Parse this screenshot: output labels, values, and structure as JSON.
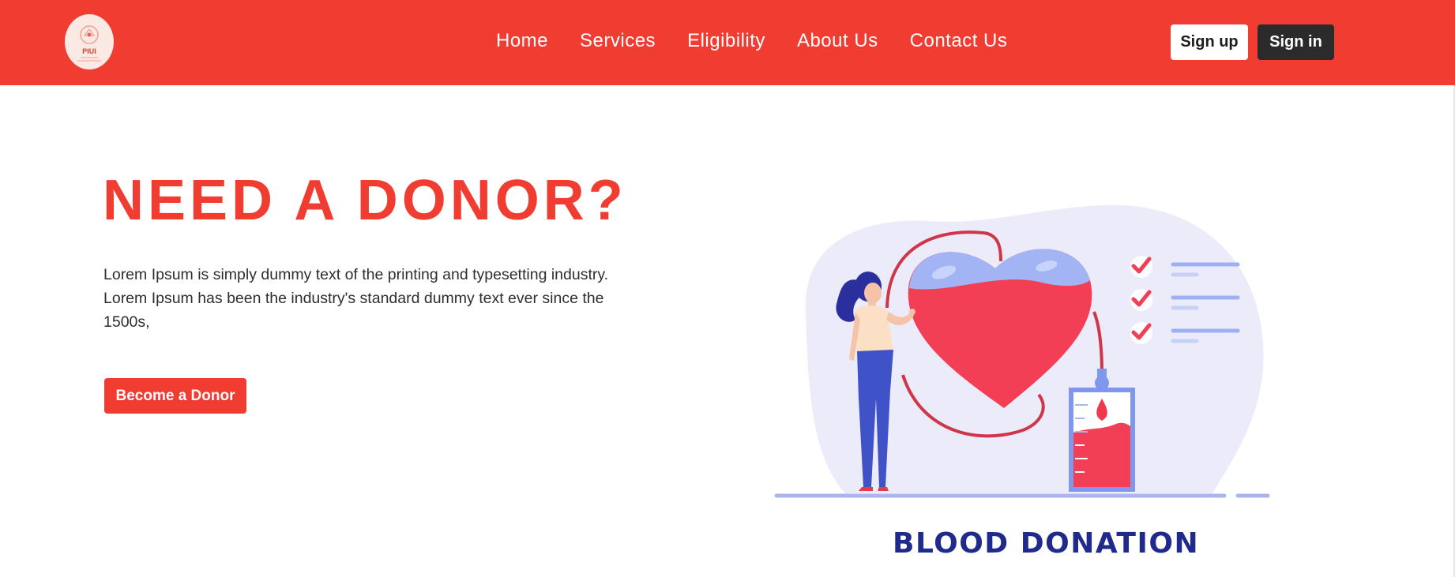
{
  "header": {
    "logo_text": "PIUI",
    "nav": [
      "Home",
      "Services",
      "Eligibility",
      "About Us",
      "Contact Us"
    ],
    "signup_label": "Sign up",
    "signin_label": "Sign in"
  },
  "hero": {
    "title": "NEED A DONOR?",
    "description": "Lorem Ipsum is simply dummy text of the printing and typesetting industry. Lorem Ipsum has been the industry's standard dummy text ever since the 1500s,",
    "cta_label": "Become a Donor"
  },
  "illustration": {
    "caption": "BLOOD DONATION"
  },
  "colors": {
    "brand_red": "#f03c31",
    "dark_button": "#2b2b2b",
    "caption_navy": "#1f2a8c"
  }
}
